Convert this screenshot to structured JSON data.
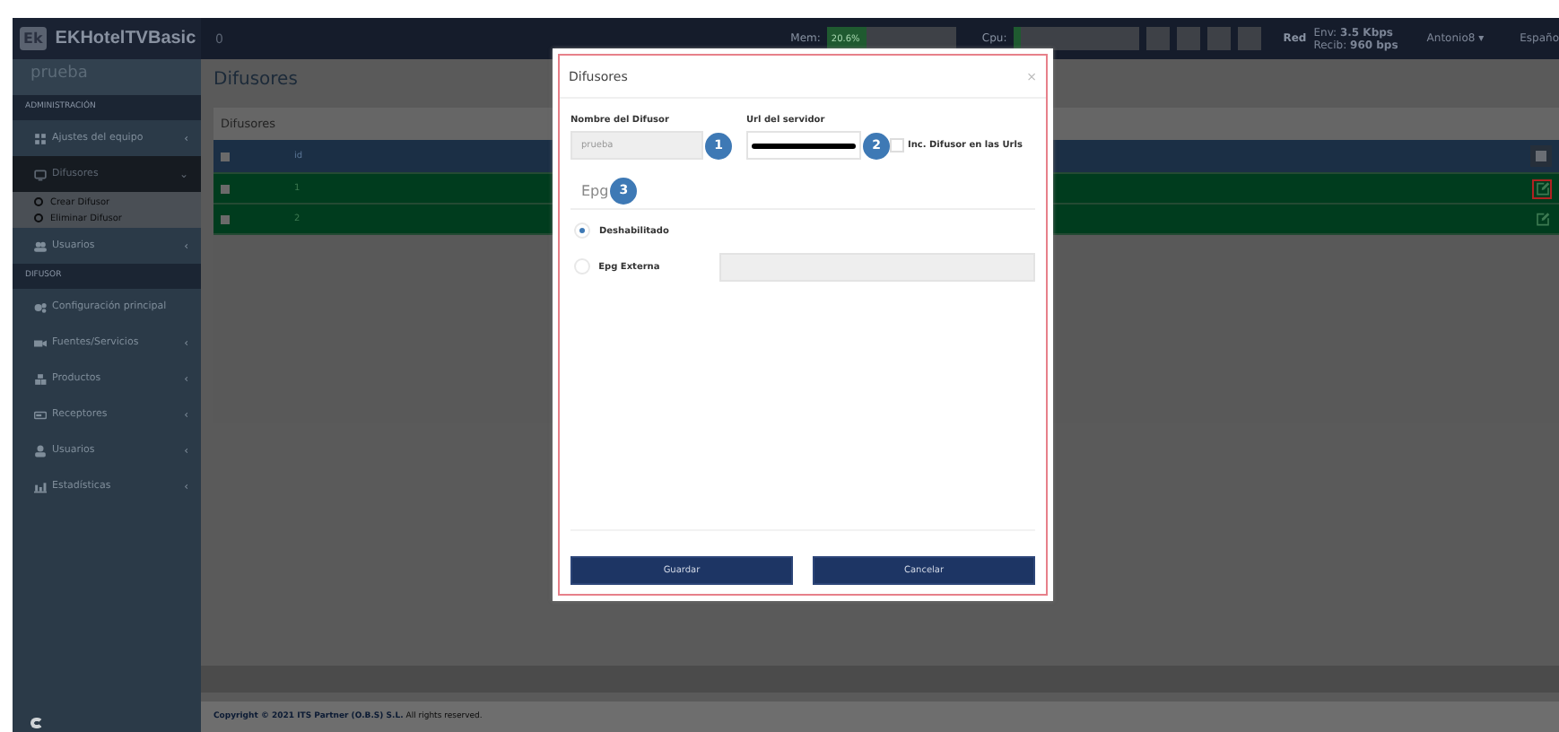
{
  "header": {
    "brand_logo": "Ek",
    "brand": "EKHotelTVBasic",
    "counter": "0",
    "memory": {
      "label": "Mem:",
      "value": "20.6%",
      "level": 0.3
    },
    "cpu": {
      "label": "Cpu:",
      "level": 0.05
    },
    "net_label": "Red",
    "net_send": "Env: **3.5 Kbps**",
    "net_recv": "Recib: **960 bps**",
    "user": "Antonio8",
    "user_caret": "▾",
    "language": "Españo"
  },
  "sidebar": {
    "user": "prueba",
    "items": [
      {
        "kind": "section",
        "label": "ADMINISTRACIÓN"
      },
      {
        "kind": "item",
        "label": "Ajustes del equipo",
        "arrow": "‹",
        "selected": false
      },
      {
        "kind": "item",
        "label": "Difusores",
        "arrow": "⌄",
        "expanded": true,
        "selected": true,
        "children": [
          {
            "label": "Crear Difusor"
          },
          {
            "label": "Eliminar Difusor"
          }
        ]
      },
      {
        "kind": "item",
        "label": "Usuarios",
        "arrow": "‹",
        "selected": false
      },
      {
        "kind": "section",
        "label": "DIFUSOR"
      },
      {
        "kind": "item",
        "label": "Configuración principal",
        "selected": false
      },
      {
        "kind": "item",
        "label": "Fuentes/Servicios",
        "arrow": "‹",
        "selected": false
      },
      {
        "kind": "item",
        "label": "Productos",
        "arrow": "‹",
        "selected": false
      },
      {
        "kind": "item",
        "label": "Receptores",
        "arrow": "‹",
        "selected": false
      },
      {
        "kind": "item",
        "label": "Usuarios",
        "arrow": "‹",
        "selected": false
      },
      {
        "kind": "item",
        "label": "Estadísticas",
        "arrow": "‹",
        "selected": false
      }
    ]
  },
  "page": {
    "title": "Difusores",
    "panel_title": "Difusores",
    "table": {
      "columns": [
        "id"
      ],
      "header_checked": false,
      "rows": [
        {
          "id": "1",
          "checked": false,
          "highlighted": true
        },
        {
          "id": "2",
          "checked": false,
          "highlighted": false
        }
      ]
    },
    "footer": "**Copyright © 2021 ITS Partner (O.B.S) S.L.** All rights reserved."
  },
  "modal": {
    "title": "Difusores",
    "close": "×",
    "name_label": "Nombre del Difusor",
    "name_value": "prueba",
    "name_badge": "1",
    "url_label": "Url del servidor",
    "url_badge": "2",
    "inc_label": "Inc. Difusor en las Urls",
    "inc_checked": false,
    "epg_title": "Epg",
    "epg_badge": "3",
    "epg_options": [
      {
        "label": "Deshabilitado",
        "selected": true
      },
      {
        "label": "Epg Externa",
        "selected": false
      }
    ],
    "buttons": [
      "Guardar",
      "Cancelar"
    ]
  }
}
